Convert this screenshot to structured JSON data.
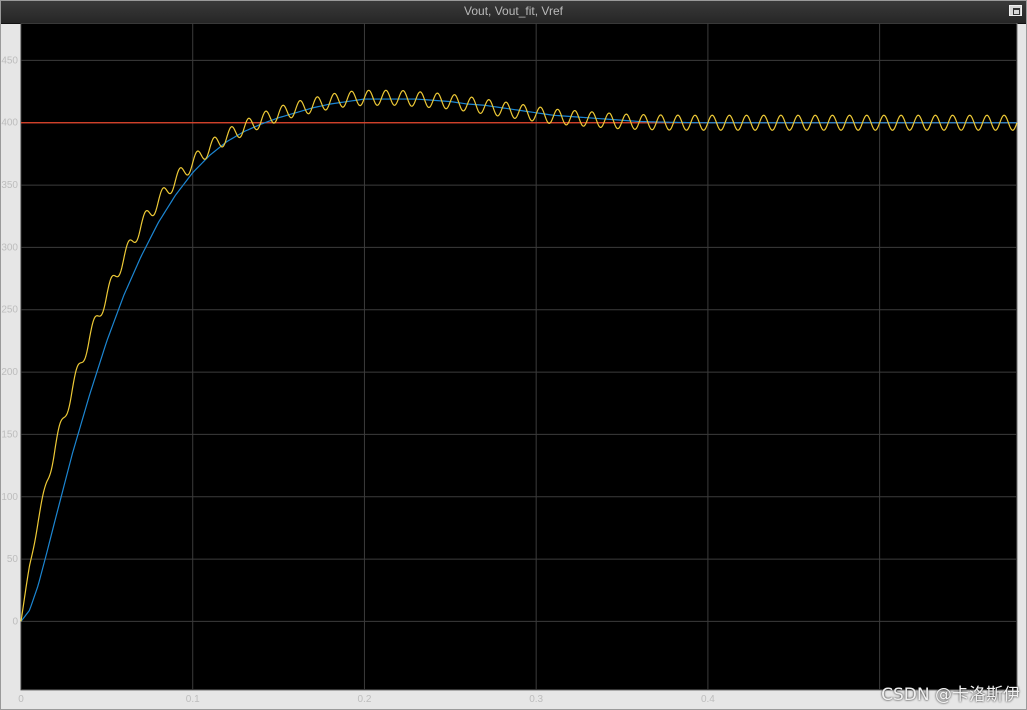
{
  "window": {
    "title": "Vout, Vout_fit, Vref",
    "watermark": "CSDN @卡洛斯伊",
    "restore_icon": "restore-window-icon"
  },
  "colors": {
    "background": "#000000",
    "grid": "#3c3c3c",
    "tick_text": "#bdbdbd",
    "vout": "#edc936",
    "vout_fit": "#1c86d2",
    "vref": "#e8452b"
  },
  "chart_data": {
    "type": "line",
    "title": "Vout, Vout_fit, Vref",
    "xlabel": "",
    "ylabel": "",
    "xlim": [
      0,
      0.58
    ],
    "ylim": [
      -55,
      480
    ],
    "grid": true,
    "legend": "none",
    "xticks": [
      0,
      0.1,
      0.2,
      0.3,
      0.4,
      0.5
    ],
    "xtick_labels": [
      "0",
      "0.1",
      "0.2",
      "0.3",
      "0.4",
      ""
    ],
    "yticks": [
      0,
      50,
      100,
      150,
      200,
      250,
      300,
      350,
      400,
      450
    ],
    "ytick_labels": [
      "0",
      "50",
      "100",
      "150",
      "200",
      "250",
      "300",
      "350",
      "400",
      "450"
    ],
    "series": [
      {
        "key": "vout_fit",
        "x": [
          0,
          0.005,
          0.01,
          0.015,
          0.02,
          0.03,
          0.04,
          0.05,
          0.06,
          0.07,
          0.08,
          0.09,
          0.1,
          0.11,
          0.12,
          0.13,
          0.14,
          0.15,
          0.16,
          0.17,
          0.18,
          0.19,
          0.2,
          0.21,
          0.22,
          0.23,
          0.24,
          0.25,
          0.26,
          0.27,
          0.28,
          0.29,
          0.3,
          0.31,
          0.32,
          0.33,
          0.34,
          0.35,
          0.36,
          0.37,
          0.38,
          0.39,
          0.4
        ],
        "values": [
          0,
          9,
          29,
          55,
          82,
          135,
          182,
          225,
          262,
          293,
          320,
          342,
          360,
          374,
          385,
          393,
          399,
          404,
          408,
          412,
          415,
          417,
          419,
          419,
          419,
          419,
          418,
          417,
          415,
          414,
          412,
          410,
          408,
          406,
          405,
          404,
          403,
          402,
          401,
          400.6,
          400.3,
          400.1,
          400
        ]
      },
      {
        "key": "vout",
        "x": [
          0,
          0.005,
          0.01,
          0.015,
          0.02,
          0.03,
          0.04,
          0.05,
          0.06,
          0.07,
          0.08,
          0.09,
          0.1,
          0.11,
          0.12,
          0.13,
          0.14,
          0.15,
          0.16,
          0.17,
          0.18,
          0.19,
          0.2,
          0.21,
          0.22,
          0.23,
          0.24,
          0.25,
          0.26,
          0.27,
          0.28,
          0.29,
          0.3,
          0.31,
          0.32,
          0.33,
          0.34,
          0.35,
          0.36,
          0.37,
          0.38,
          0.39,
          0.4,
          0.58
        ],
        "values": [
          0,
          45,
          80,
          112,
          140,
          187,
          228,
          262,
          292,
          318,
          337,
          354,
          368,
          380,
          389,
          396,
          402,
          407,
          411,
          414,
          417,
          419,
          420,
          420,
          420,
          419,
          418,
          417,
          415,
          413,
          411,
          409,
          407,
          405,
          404,
          403,
          402,
          401,
          400.6,
          400.3,
          400.1,
          400,
          400,
          400
        ],
        "ripple_amplitude": 6,
        "ripple_period": 0.01
      },
      {
        "key": "vref",
        "x": [
          0,
          0.58
        ],
        "values": [
          400,
          400
        ]
      }
    ]
  }
}
